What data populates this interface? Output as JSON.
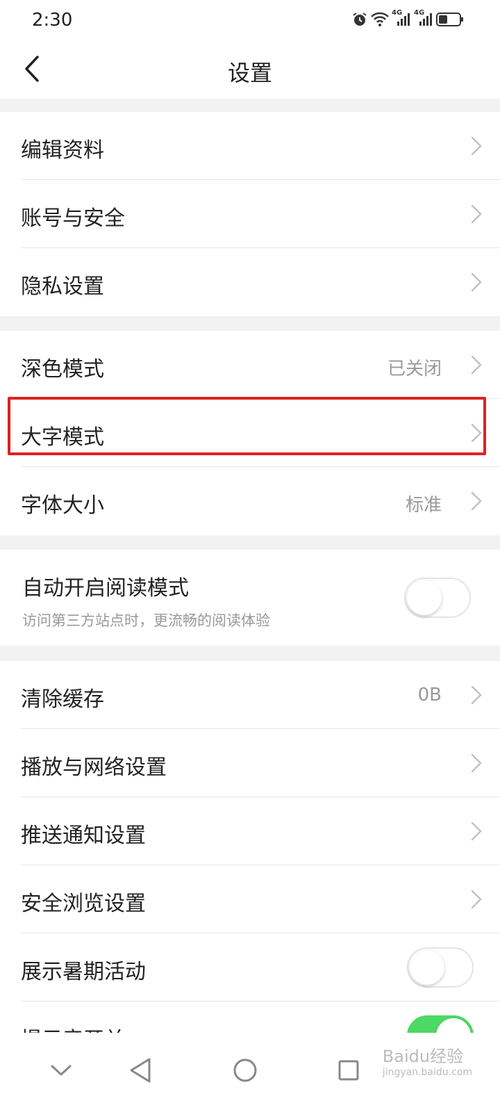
{
  "status_bar": {
    "time": "2:30",
    "net1": "4G",
    "net2": "4G"
  },
  "header": {
    "title": "设置",
    "back_icon": "chevron-left-icon"
  },
  "groups": [
    {
      "items": [
        {
          "label": "编辑资料",
          "value": "",
          "control": "chevron"
        },
        {
          "label": "账号与安全",
          "value": "",
          "control": "chevron"
        },
        {
          "label": "隐私设置",
          "value": "",
          "control": "chevron"
        }
      ]
    },
    {
      "items": [
        {
          "label": "深色模式",
          "value": "已关闭",
          "control": "chevron"
        },
        {
          "label": "大字模式",
          "value": "",
          "control": "chevron",
          "highlighted": true
        },
        {
          "label": "字体大小",
          "value": "标准",
          "control": "chevron"
        }
      ]
    },
    {
      "items": [
        {
          "label": "自动开启阅读模式",
          "sub": "访问第三方站点时，更流畅的阅读体验",
          "control": "toggle",
          "on": false
        }
      ]
    },
    {
      "items": [
        {
          "label": "清除缓存",
          "value": "0B",
          "control": "chevron"
        },
        {
          "label": "播放与网络设置",
          "value": "",
          "control": "chevron"
        },
        {
          "label": "推送通知设置",
          "value": "",
          "control": "chevron"
        },
        {
          "label": "安全浏览设置",
          "value": "",
          "control": "chevron"
        },
        {
          "label": "展示暑期活动",
          "control": "toggle",
          "on": false
        },
        {
          "label": "提示音开关",
          "control": "toggle",
          "on": true
        }
      ]
    }
  ],
  "highlight_color": "#e02020",
  "toggle_on_color": "#4cd964",
  "nav": {
    "icons": [
      "chevron-down-icon",
      "back-triangle-icon",
      "home-circle-icon",
      "recents-square-icon"
    ]
  },
  "watermark": {
    "brand": "Baidu经验",
    "url": "jingyan.baidu.com"
  }
}
